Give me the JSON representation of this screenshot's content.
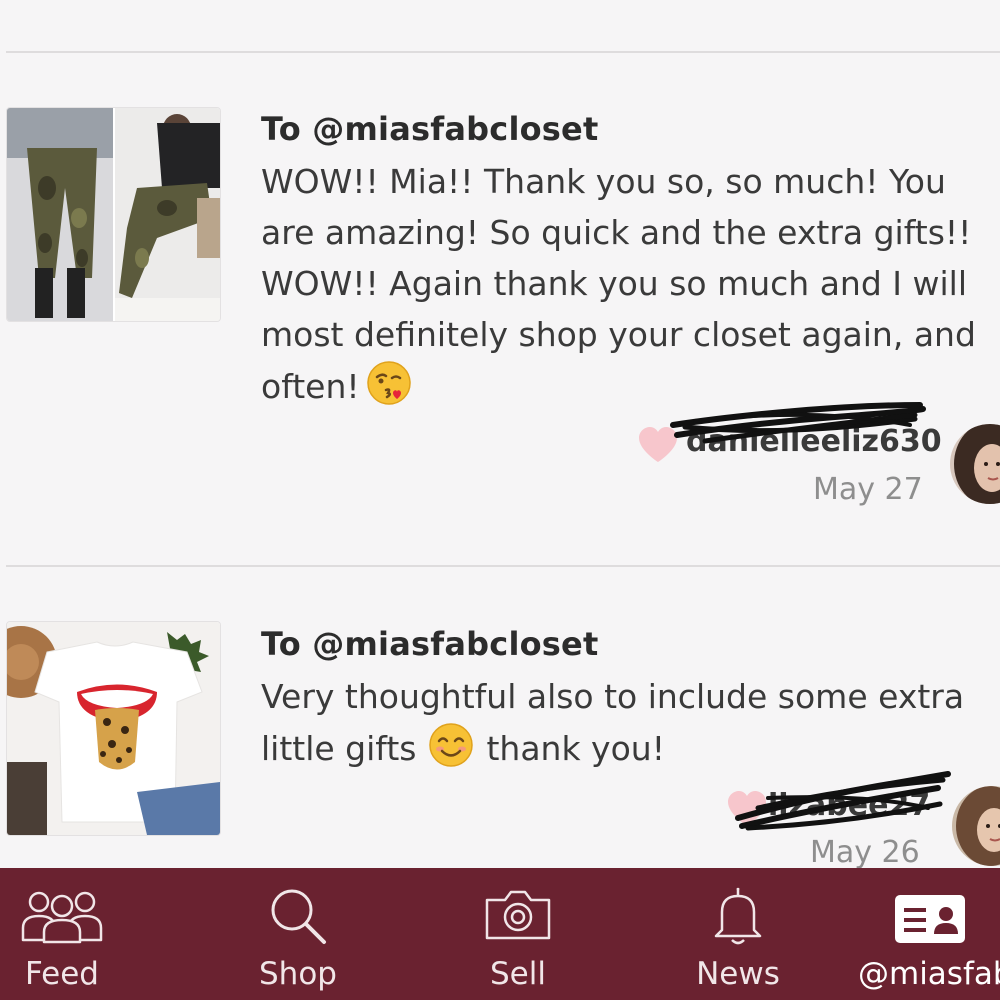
{
  "reviews": [
    {
      "to": "To @miasfabcloset",
      "lines": [
        "WOW!! Mia!! Thank you so, so much! You",
        "are amazing! So quick and the extra gifts!!",
        "WOW!! Again thank you so much and I will",
        "most definitely shop your closet again, and",
        "often!"
      ],
      "emoji": "kissing-face-emoji",
      "username": "danielleeliz630",
      "date": "May 27"
    },
    {
      "to": "To @miasfabcloset",
      "lines": [
        "Very thoughtful also to include some extra",
        "little gifts"
      ],
      "line2_suffix": "thank you!",
      "emoji": "smiling-face-emoji",
      "username": "lizabee27",
      "date": "May 26"
    }
  ],
  "tabbar": {
    "tabs": [
      {
        "label": "Feed",
        "icon": "people-icon"
      },
      {
        "label": "Shop",
        "icon": "search-icon"
      },
      {
        "label": "Sell",
        "icon": "camera-icon"
      },
      {
        "label": "News",
        "icon": "bell-icon"
      },
      {
        "label": "@miasfabcloset",
        "icon": "profile-card-icon"
      }
    ]
  },
  "colors": {
    "tabbar_bg": "#6a2230",
    "heart": "#f7c6cc",
    "divider": "#dedcdd"
  }
}
